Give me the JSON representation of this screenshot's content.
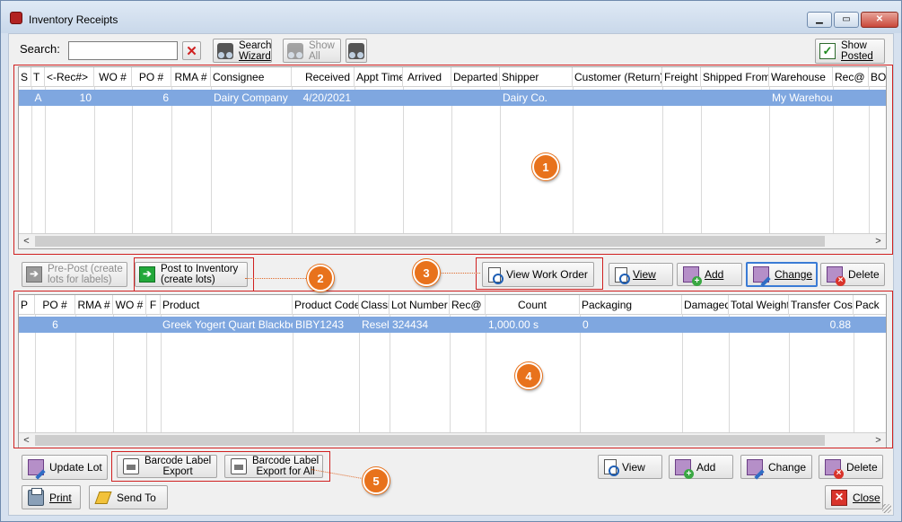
{
  "window": {
    "title": "Inventory Receipts"
  },
  "toolbar": {
    "search_label": "Search:",
    "search_value": "",
    "search_wizard_line1": "Search",
    "search_wizard_line2": "Wizard",
    "show_all_line1": "Show",
    "show_all_line2": "All",
    "show_posted_line1": "Show",
    "show_posted_line2": "Posted"
  },
  "receipts_grid": {
    "columns": [
      "S",
      "T",
      "<-Rec#>",
      "WO #",
      "PO #",
      "RMA #",
      "Consignee",
      "Received",
      "Appt Time",
      "Arrived",
      "Departed",
      "Shipper",
      "Customer (Return)",
      "Freight (",
      "Shipped From",
      "Warehouse",
      "Rec@",
      "BO"
    ],
    "rows": [
      {
        "s": "",
        "t": "A",
        "rec": "10",
        "wo": "",
        "po": "6",
        "rma": "",
        "consignee": "Dairy Company",
        "received": "4/20/2021",
        "appt": "",
        "arrived": "",
        "departed": "",
        "shipper": "Dairy Co.",
        "customer": "",
        "freight": "",
        "shipped_from": "",
        "warehouse": "My Warehouse",
        "rec_at": "",
        "bo": ""
      }
    ]
  },
  "mid_buttons": {
    "prepost_line1": "Pre-Post (create",
    "prepost_line2": "lots for labels)",
    "post_line1": "Post to Inventory",
    "post_line2": "(create lots)",
    "view_work_order": "View Work Order",
    "view": "View",
    "add": "Add",
    "change": "Change",
    "delete": "Delete"
  },
  "lines_grid": {
    "columns": [
      "P",
      "PO #",
      "RMA #",
      "WO #",
      "F",
      "Product",
      "Product Code",
      "Classif",
      "Lot Number",
      "Rec@",
      "Count",
      "Packaging",
      "Damaged",
      "Total Weight",
      "Transfer Cost",
      "Pack"
    ],
    "rows": [
      {
        "p": "",
        "po": "6",
        "rma": "",
        "wo": "",
        "f": "",
        "product": "Greek Yogert Quart Blackberry",
        "code": "BIBY1243",
        "classif": "Resell",
        "lot": "324434",
        "rec_at": "",
        "count": "1,000.00 s",
        "packaging": "0",
        "damaged": "",
        "weight": "",
        "transfer_cost": "0.88",
        "pack": ""
      }
    ]
  },
  "bottom_buttons": {
    "update_lot": "Update Lot",
    "barcode_export_line1": "Barcode Label",
    "barcode_export_line2": "Export",
    "barcode_all_line1": "Barcode Label",
    "barcode_all_line2": "Export for All",
    "view": "View",
    "add": "Add",
    "change": "Change",
    "delete": "Delete",
    "print": "Print",
    "send_to": "Send To",
    "close": "Close"
  },
  "callouts": [
    "1",
    "2",
    "3",
    "4",
    "5"
  ],
  "colors": {
    "selection": "#7fa7e0",
    "callout": "#e8721c",
    "highlight_box": "#d02020"
  }
}
